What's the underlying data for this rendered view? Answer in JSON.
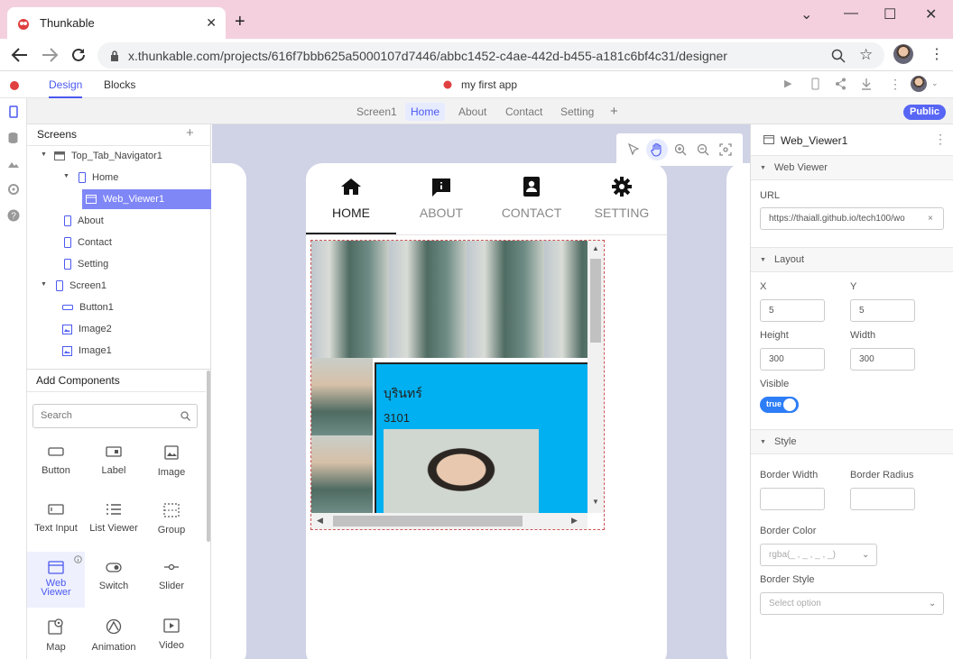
{
  "browser": {
    "tab_title": "Thunkable",
    "url": "x.thunkable.com/projects/616f7bbb625a5000107d7446/abbc1452-c4ae-442d-b455-a181c6bf4c31/designer"
  },
  "app_header": {
    "tabs": [
      "Design",
      "Blocks"
    ],
    "project_name": "my first app"
  },
  "screen_tabs": [
    "Screen1",
    "Home",
    "About",
    "Contact",
    "Setting"
  ],
  "public_label": "Public",
  "screens_panel": {
    "title": "Screens",
    "tree": [
      {
        "label": "Top_Tab_Navigator1",
        "icon": "navigator-icon"
      },
      {
        "label": "Home",
        "icon": "phone-icon"
      },
      {
        "label": "Web_Viewer1",
        "icon": "web-viewer-icon"
      },
      {
        "label": "About",
        "icon": "phone-icon"
      },
      {
        "label": "Contact",
        "icon": "phone-icon"
      },
      {
        "label": "Setting",
        "icon": "phone-icon"
      },
      {
        "label": "Screen1",
        "icon": "phone-icon"
      },
      {
        "label": "Button1",
        "icon": "button-icon"
      },
      {
        "label": "Image2",
        "icon": "image-icon"
      },
      {
        "label": "Image1",
        "icon": "image-icon"
      }
    ]
  },
  "add_components": {
    "title": "Add Components",
    "search_placeholder": "Search",
    "items": [
      "Button",
      "Label",
      "Image",
      "Text Input",
      "List Viewer",
      "Group",
      "Web Viewer",
      "Switch",
      "Slider",
      "Map",
      "Animation",
      "Video"
    ]
  },
  "phone": {
    "nav_tabs": [
      "HOME",
      "ABOUT",
      "CONTACT",
      "SETTING"
    ],
    "web_content": {
      "name": "บุรินทร์",
      "number": "3101"
    }
  },
  "properties": {
    "component_name": "Web_Viewer1",
    "sections": {
      "web_viewer": "Web Viewer",
      "layout": "Layout",
      "style": "Style"
    },
    "url_label": "URL",
    "url_value": "https://thaiall.github.io/tech100/wo",
    "x_label": "X",
    "x_value": "5",
    "y_label": "Y",
    "y_value": "5",
    "height_label": "Height",
    "height_value": "300",
    "width_label": "Width",
    "width_value": "300",
    "visible_label": "Visible",
    "visible_value": "true",
    "border_width_label": "Border Width",
    "border_radius_label": "Border Radius",
    "border_color_label": "Border Color",
    "border_color_value": "rgba(_ , _ , _ , _)",
    "border_style_label": "Border Style",
    "border_style_placeholder": "Select option"
  },
  "colors": {
    "accent": "#5866f5",
    "selected_tree": "#7f86f6",
    "web_panel": "#00b0f0"
  }
}
